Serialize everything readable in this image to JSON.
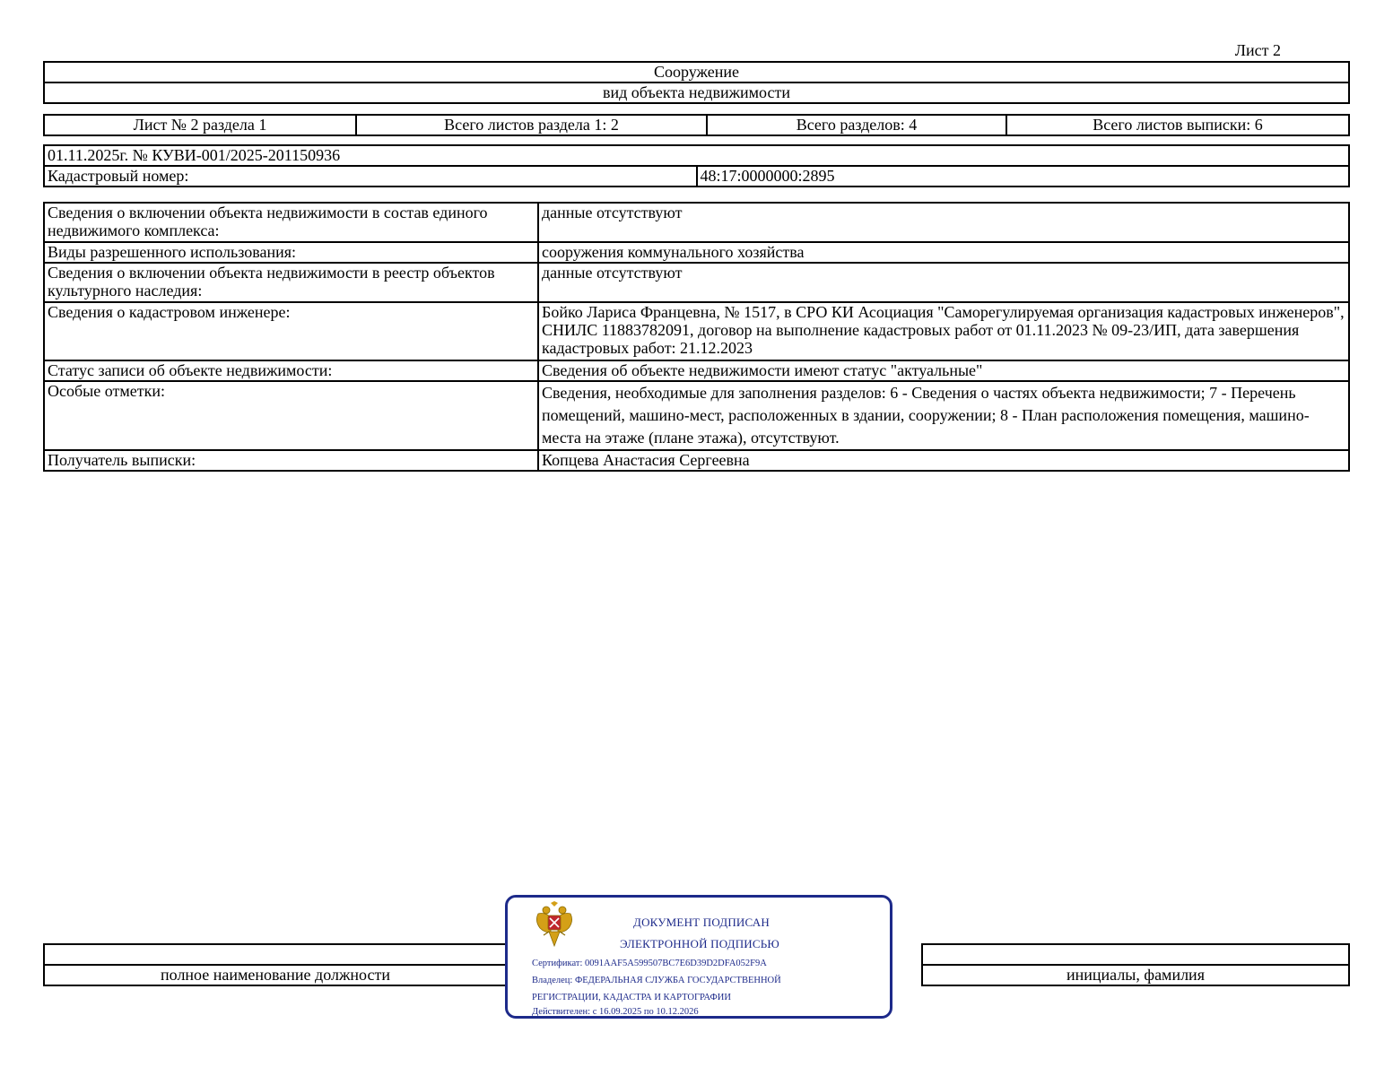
{
  "sheet_label": "Лист 2",
  "header": {
    "object_type": "Сооружение",
    "object_type_caption": "вид объекта недвижимости"
  },
  "meta": {
    "sheet_of_section": "Лист № 2 раздела 1",
    "total_sheets_section": "Всего листов раздела 1: 2",
    "total_sections": "Всего разделов: 4",
    "total_sheets_extract": "Всего листов выписки: 6"
  },
  "ident": {
    "date_number": "01.11.2025г. № КУВИ-001/2025-201150936",
    "cadastral_label": "Кадастровый номер:",
    "cadastral_value": "48:17:0000000:2895"
  },
  "info": {
    "complex_label": "Сведения о включении объекта недвижимости в состав единого недвижимого комплекса:",
    "complex_value": "данные отсутствуют",
    "usage_label": "Виды разрешенного использования:",
    "usage_value": "сооружения коммунального хозяйства",
    "heritage_label": "Сведения о включении объекта недвижимости в реестр объектов культурного наследия:",
    "heritage_value": "данные отсутствуют",
    "engineer_label": "Сведения о кадастровом инженере:",
    "engineer_value": "Бойко Лариса Францевна, № 1517, в СРО КИ Асоциация \"Саморегулируемая организация кадастровых инженеров\", СНИЛС 11883782091, договор на выполнение кадастровых работ от 01.11.2023 № 09-23/ИП, дата завершения кадастровых работ: 21.12.2023",
    "status_label": "Статус записи об объекте недвижимости:",
    "status_value": "Сведения об объекте недвижимости имеют статус \"актуальные\"",
    "notes_label": "Особые отметки:",
    "notes_value": "Сведения, необходимые для заполнения разделов: 6 - Сведения о частях объекта недвижимости; 7 - Перечень помещений, машино-мест, расположенных в здании, сооружении; 8 - План расположения помещения, машино-места на этаже (плане этажа), отсутствуют.",
    "recipient_label": "Получатель выписки:",
    "recipient_value": "Копцева Анастасия Сергеевна"
  },
  "signature": {
    "position_caption": "полное наименование должности",
    "initials_caption": "инициалы, фамилия"
  },
  "stamp": {
    "line1": "ДОКУМЕНТ ПОДПИСАН",
    "line2": "ЭЛЕКТРОННОЙ ПОДПИСЬЮ",
    "certificate": "Сертификат: 0091AAF5A599507BC7E6D39D2DFA052F9A",
    "owner_line1": "Владелец: ФЕДЕРАЛЬНАЯ СЛУЖБА ГОСУДАРСТВЕННОЙ",
    "owner_line2": "РЕГИСТРАЦИИ, КАДАСТРА И КАРТОГРАФИИ",
    "validity": "Действителен: с 16.09.2025 по 10.12.2026",
    "emblem_icon": "double-headed-eagle-emblem-icon",
    "color": "#1d2a8a"
  }
}
